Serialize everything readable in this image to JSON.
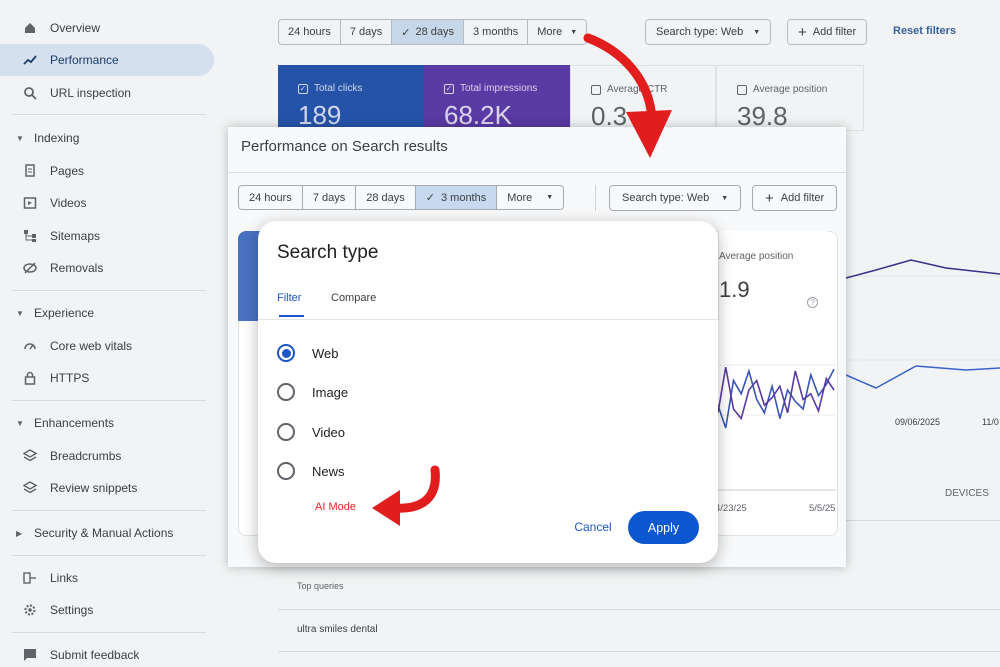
{
  "sidebar": {
    "items": [
      {
        "label": "Overview",
        "icon": "home-icon"
      },
      {
        "label": "Performance",
        "icon": "trending-icon"
      },
      {
        "label": "URL inspection",
        "icon": "search-icon"
      }
    ],
    "sections": [
      {
        "label": "Indexing",
        "items": [
          {
            "label": "Pages",
            "icon": "pages-icon"
          },
          {
            "label": "Videos",
            "icon": "video-icon"
          },
          {
            "label": "Sitemaps",
            "icon": "sitemap-icon"
          },
          {
            "label": "Removals",
            "icon": "removals-icon"
          }
        ]
      },
      {
        "label": "Experience",
        "items": [
          {
            "label": "Core web vitals",
            "icon": "gauge-icon"
          },
          {
            "label": "HTTPS",
            "icon": "lock-icon"
          }
        ]
      },
      {
        "label": "Enhancements",
        "items": [
          {
            "label": "Breadcrumbs",
            "icon": "layers-icon"
          },
          {
            "label": "Review snippets",
            "icon": "layers-icon"
          }
        ]
      },
      {
        "label": "Security & Manual Actions",
        "items": []
      }
    ],
    "bottom": [
      {
        "label": "Links",
        "icon": "links-icon"
      },
      {
        "label": "Settings",
        "icon": "gear-icon"
      },
      {
        "label": "Submit feedback",
        "icon": "feedback-icon"
      }
    ]
  },
  "bg_toolbar": {
    "ranges": [
      "24 hours",
      "7 days",
      "28 days",
      "3 months",
      "More"
    ],
    "selected_range": "28 days",
    "search_type": "Search type: Web",
    "add_filter": "Add filter",
    "reset": "Reset filters"
  },
  "bg_metrics": [
    {
      "label": "Total clicks",
      "value": "189",
      "checked": true,
      "color": "#2553a8"
    },
    {
      "label": "Total impressions",
      "value": "68.2K",
      "checked": true,
      "color": "#5a3aa3"
    },
    {
      "label": "Average CTR",
      "value": "0.3",
      "checked": false,
      "color": "#f1f3f4"
    },
    {
      "label": "Average position",
      "value": "39.8",
      "checked": false,
      "color": "#f1f3f4"
    }
  ],
  "bg_chart": {
    "dates": [
      "09/06/2025",
      "11/0"
    ],
    "label": "DEVICES"
  },
  "bg_table": {
    "header": "Top queries",
    "rows": [
      "ultra smiles dental"
    ]
  },
  "panel": {
    "title": "Performance on Search results",
    "ranges": [
      "24 hours",
      "7 days",
      "28 days",
      "3 months",
      "More"
    ],
    "selected_range": "3 months",
    "search_type": "Search type: Web",
    "add_filter": "Add filter",
    "avg_label": "Average position",
    "avg_value": "1.9",
    "chart": {
      "dates": [
        "4/23/25",
        "5/5/25"
      ],
      "series": [
        {
          "color": "#3a56b4",
          "values": [
            42,
            30,
            55,
            48,
            60,
            45,
            38,
            52,
            35,
            50,
            44,
            40,
            58,
            47,
            53,
            61
          ]
        },
        {
          "color": "#5a3aa3",
          "values": [
            38,
            62,
            40,
            35,
            50,
            55,
            42,
            46,
            52,
            38,
            60,
            45,
            48,
            39,
            56,
            50
          ]
        }
      ]
    }
  },
  "dialog": {
    "title": "Search type",
    "tabs": [
      "Filter",
      "Compare"
    ],
    "active_tab": "Filter",
    "options": [
      "Web",
      "Image",
      "Video",
      "News"
    ],
    "selected": "Web",
    "ai_mode": "AI Mode",
    "cancel": "Cancel",
    "apply": "Apply"
  },
  "colors": {
    "accent": "#0b57d0",
    "annotation_red": "#e62222"
  }
}
